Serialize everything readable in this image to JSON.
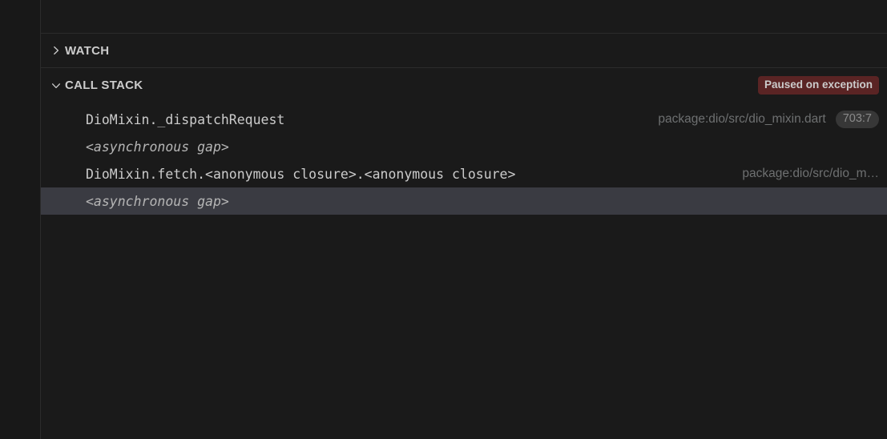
{
  "colors": {
    "panel_background": "#1a1a1a",
    "rail_background": "#181818",
    "section_border": "#2b2b2b",
    "selected_row_background": "#3a3b42",
    "paused_badge_background": "#5a2424",
    "paused_badge_text": "#cccccc",
    "section_title_text": "#cccccc",
    "frame_name_text": "#cccccc",
    "frame_source_text": "#6e7071",
    "line_badge_background": "#373737",
    "line_badge_text": "#8a8a8a"
  },
  "sections": {
    "watch": {
      "title": "WATCH",
      "twisty_icon": "chevron-right-icon",
      "expanded": false
    },
    "call_stack": {
      "title": "CALL STACK",
      "twisty_icon": "chevron-down-icon",
      "expanded": true,
      "badge": {
        "label": "Paused on exception"
      },
      "frames": [
        {
          "name": "DioMixin._dispatchRequest",
          "is_gap": false,
          "source": "package:dio/src/dio_mixin.dart",
          "line": "703:7",
          "selected": false
        },
        {
          "name": "<asynchronous gap>",
          "is_gap": true,
          "source": "",
          "line": "",
          "selected": false
        },
        {
          "name": "DioMixin.fetch.<anonymous closure>.<anonymous closure>",
          "is_gap": false,
          "source": "package:dio/src/dio_m…",
          "line": "",
          "selected": false
        },
        {
          "name": "<asynchronous gap>",
          "is_gap": true,
          "source": "",
          "line": "",
          "selected": true
        }
      ]
    }
  }
}
